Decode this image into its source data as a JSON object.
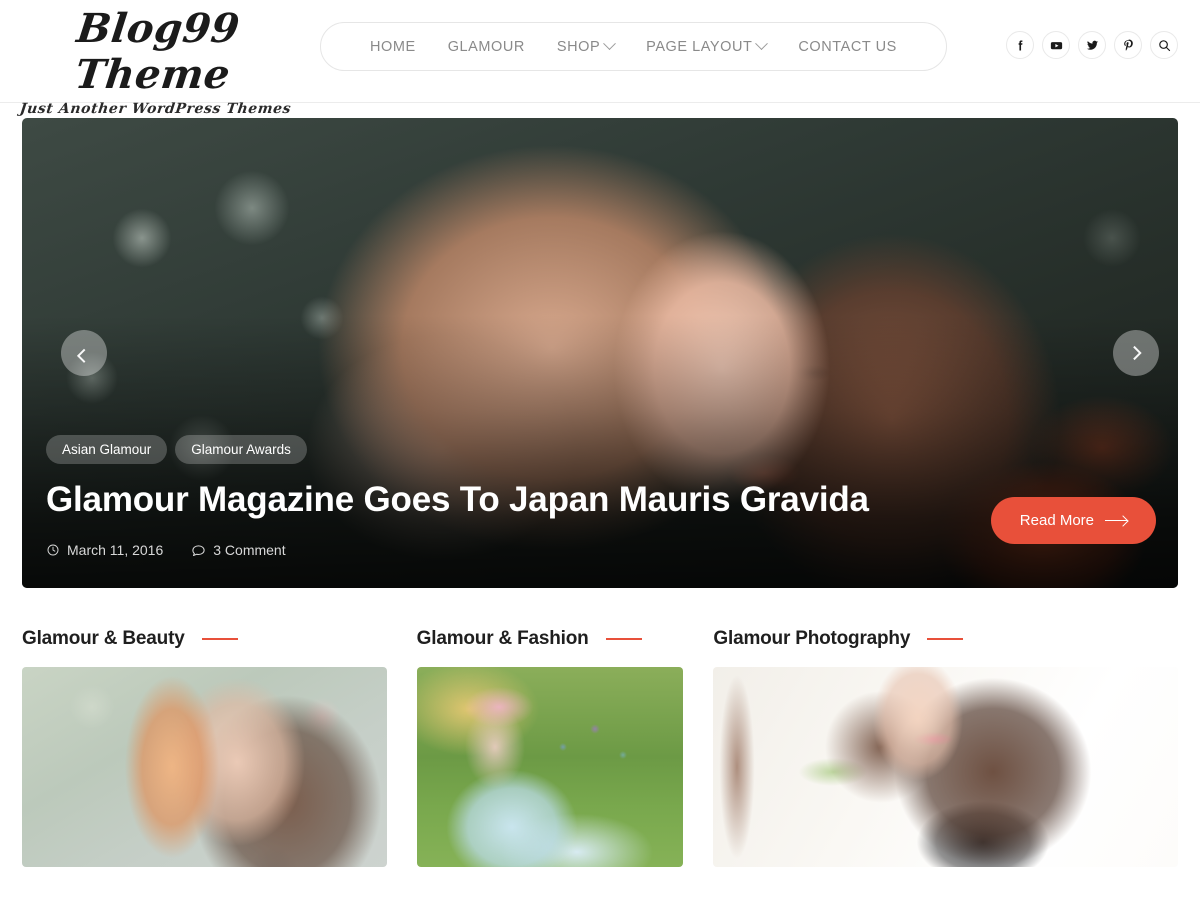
{
  "header": {
    "brand_title": "Blog99 Theme",
    "brand_tagline": "Just Another WordPress Themes",
    "nav": [
      {
        "label": "HOME",
        "has_dropdown": false
      },
      {
        "label": "GLAMOUR",
        "has_dropdown": false
      },
      {
        "label": "SHOP",
        "has_dropdown": true
      },
      {
        "label": "PAGE LAYOUT",
        "has_dropdown": true
      },
      {
        "label": "CONTACT US",
        "has_dropdown": false
      }
    ],
    "social": [
      {
        "name": "facebook-icon",
        "label": "Facebook"
      },
      {
        "name": "youtube-icon",
        "label": "YouTube"
      },
      {
        "name": "twitter-icon",
        "label": "Twitter"
      },
      {
        "name": "pinterest-icon",
        "label": "Pinterest"
      },
      {
        "name": "search-icon",
        "label": "Search"
      }
    ]
  },
  "hero": {
    "tags": [
      "Asian Glamour",
      "Glamour Awards"
    ],
    "title": "Glamour Magazine Goes To Japan Mauris Gravida",
    "date": "March 11, 2016",
    "comments": "3 Comment",
    "read_more": "Read More",
    "prev_label": "Previous slide",
    "next_label": "Next slide"
  },
  "sections": [
    {
      "title": "Glamour & Beauty"
    },
    {
      "title": "Glamour & Fashion"
    },
    {
      "title": "Glamour Photography"
    }
  ],
  "colors": {
    "accent": "#e8503a",
    "nav_text": "#8a8a8a",
    "heading": "#1f1f1f",
    "header_border": "#ececec"
  }
}
